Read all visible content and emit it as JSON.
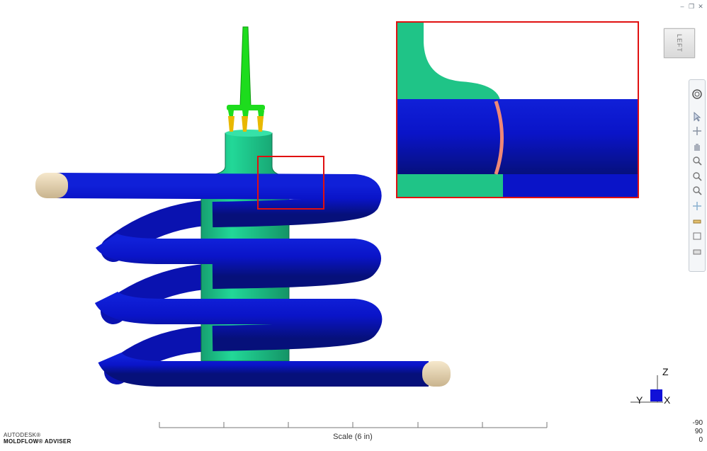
{
  "window": {
    "minimize_glyph": "–",
    "restore_glyph": "❐",
    "close_glyph": "✕"
  },
  "view_cube": {
    "face_label": "LEFT"
  },
  "navigation_bar": {
    "tools": [
      {
        "name": "steering-wheel-icon"
      },
      {
        "name": "select-icon"
      },
      {
        "name": "orbit-icon"
      },
      {
        "name": "pan-icon"
      },
      {
        "name": "zoom-icon"
      },
      {
        "name": "zoom-window-icon"
      },
      {
        "name": "zoom-extents-icon"
      },
      {
        "name": "center-icon"
      },
      {
        "name": "section-icon"
      },
      {
        "name": "view-icon"
      },
      {
        "name": "print-icon"
      }
    ]
  },
  "brand": {
    "line1": "AUTODESK®",
    "line2": "MOLDFLOW® ADVISER"
  },
  "scale": {
    "label": "Scale (6 in)"
  },
  "readout": {
    "values": [
      "-90",
      "90",
      "0"
    ]
  },
  "triad": {
    "z": "Z",
    "y": "Y",
    "x": "X"
  },
  "colors": {
    "coil": "#0a14c8",
    "core": "#1fc487",
    "sprue": "#1ddc1d",
    "gate": "#e8b800",
    "end_cap": "#efdcb8",
    "highlight_box": "#e01010",
    "weld_line": "#ee8877"
  }
}
